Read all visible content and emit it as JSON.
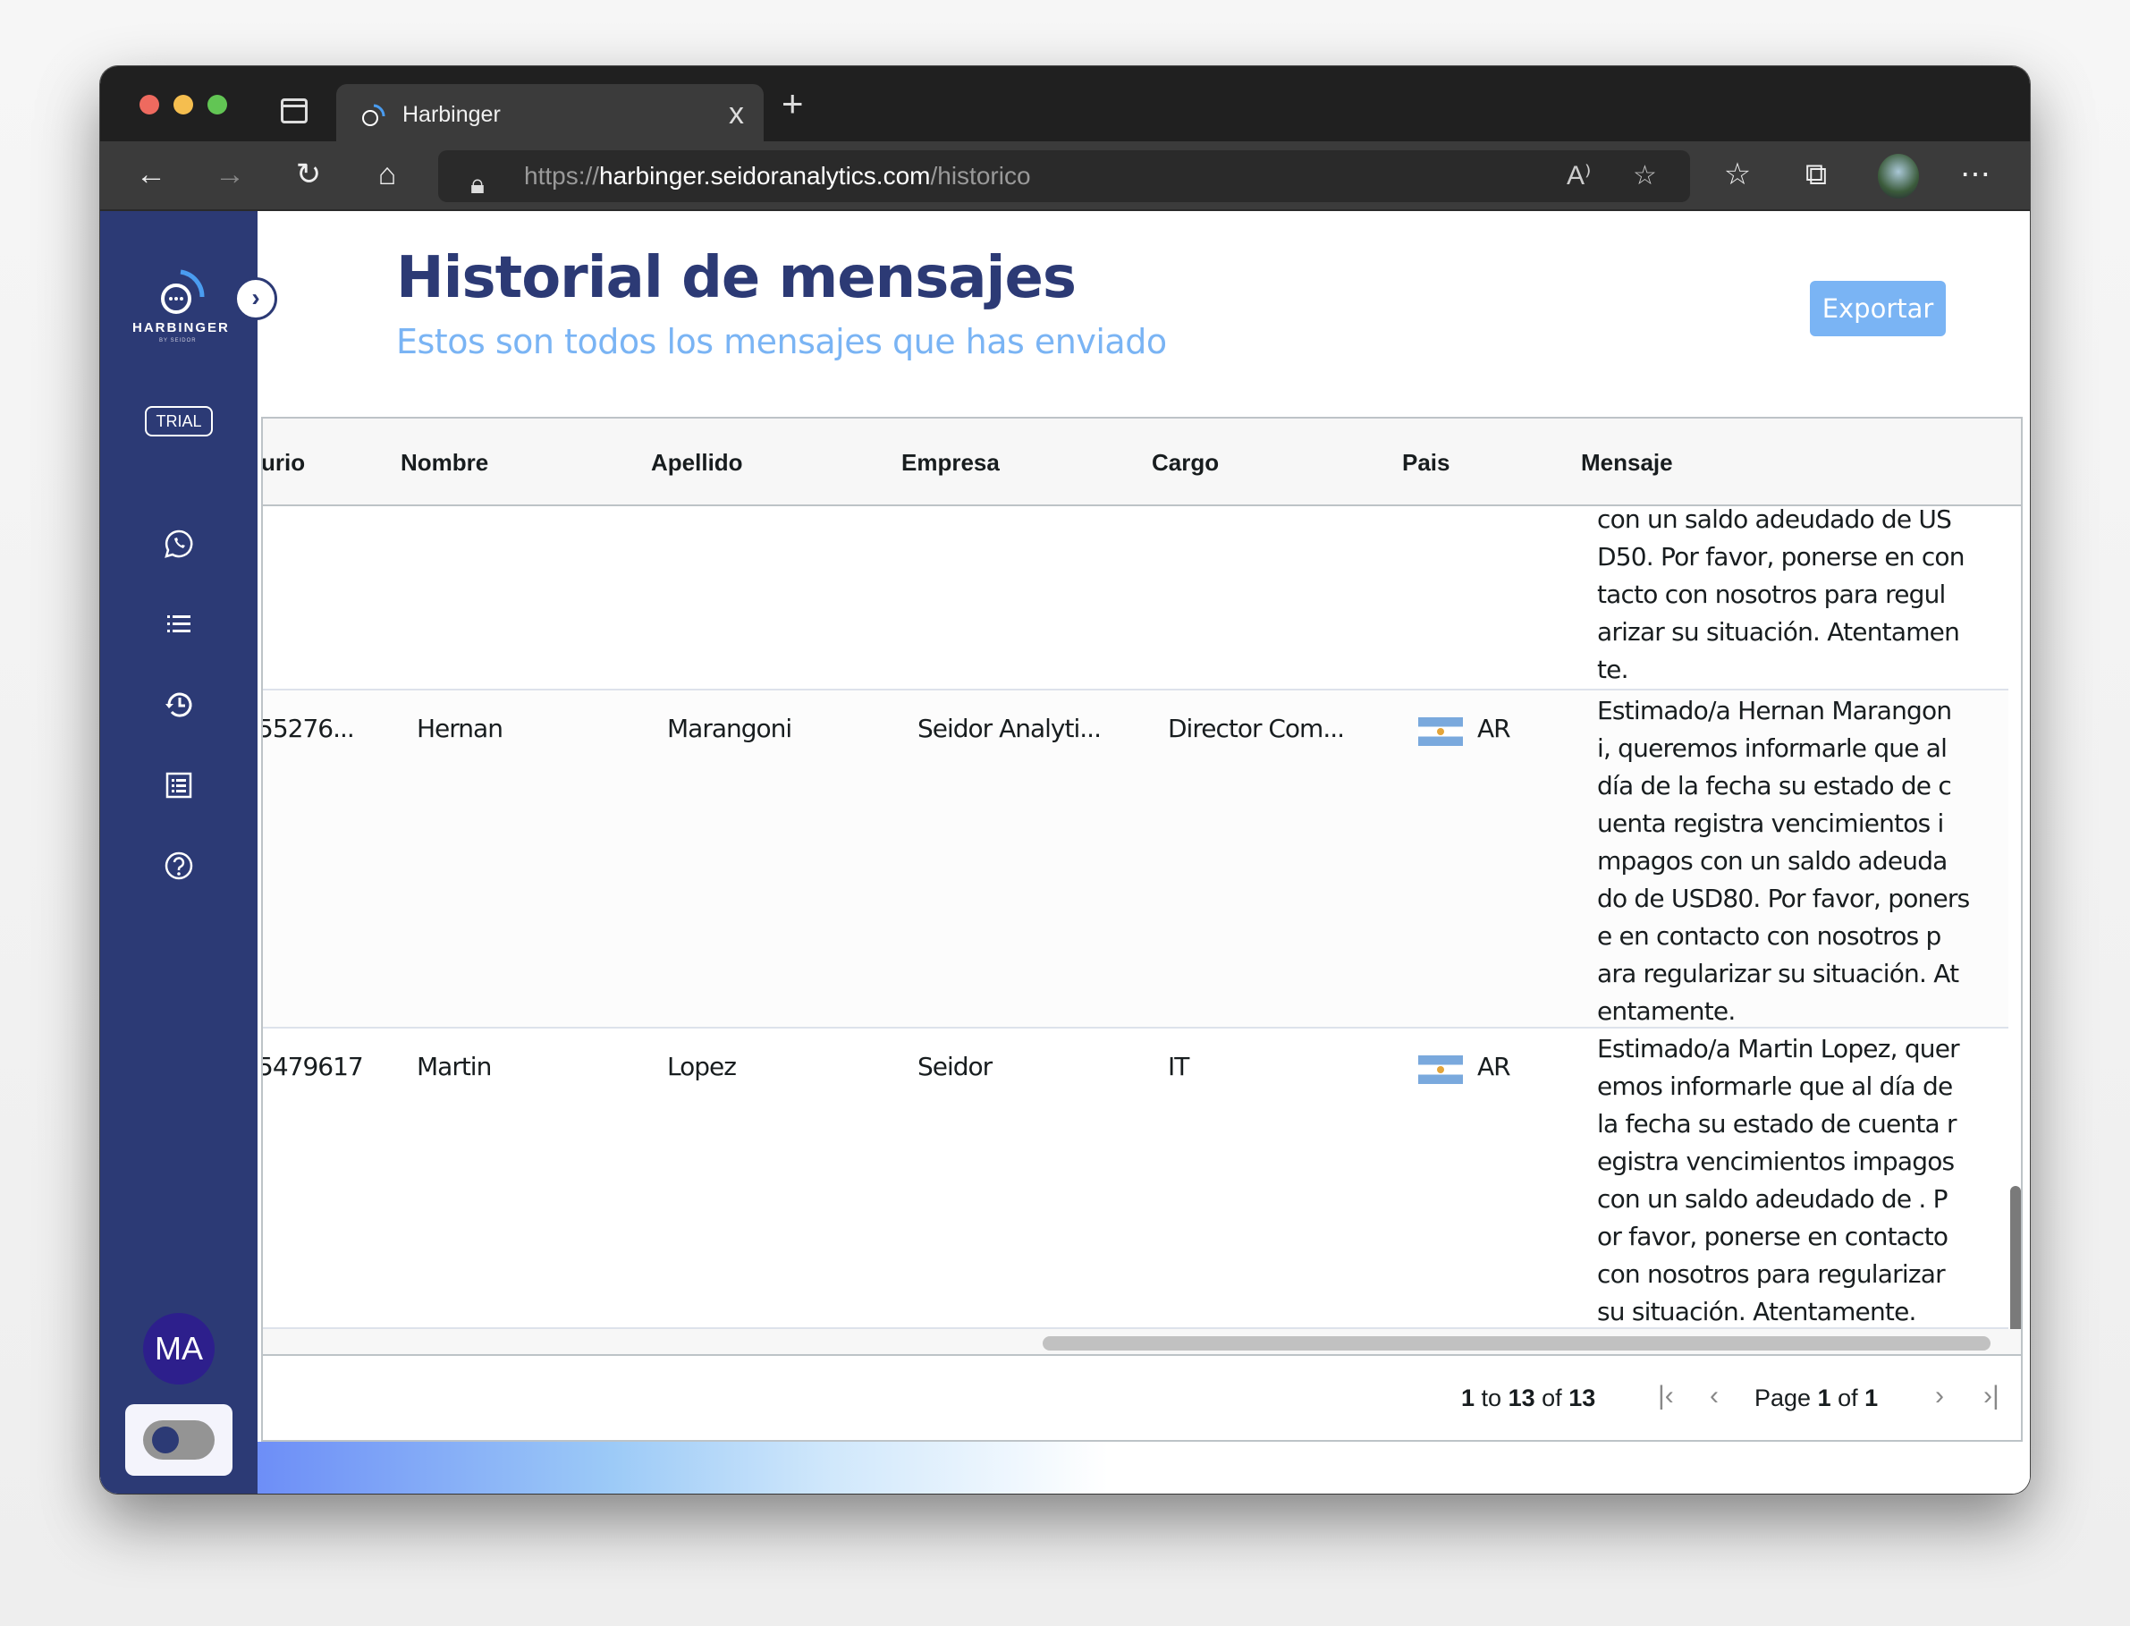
{
  "browser": {
    "tab_title": "Harbinger",
    "tab_close": "x",
    "new_tab": "+",
    "url_prefix": "https://",
    "url_host": "harbinger.seidoranalytics.com",
    "url_path": "/historico",
    "icons": [
      "sidebar-toggle-icon",
      "back-icon",
      "forward-icon",
      "refresh-icon",
      "home-icon",
      "lock-icon",
      "read-aloud-icon",
      "add-favorite-icon",
      "favorites-icon",
      "collections-icon",
      "profile-avatar",
      "more-icon"
    ]
  },
  "sidebar": {
    "logo_name": "HARBINGER",
    "logo_by": "BY SEIDOR",
    "collapse_icon": "›",
    "trial_badge": "TRIAL",
    "items": [
      {
        "name": "whatsapp",
        "icon": "whatsapp-icon"
      },
      {
        "name": "lists",
        "icon": "list-icon"
      },
      {
        "name": "history",
        "icon": "history-icon"
      },
      {
        "name": "templates",
        "icon": "list-box-icon"
      },
      {
        "name": "help",
        "icon": "help-icon"
      }
    ],
    "user_initials": "MA",
    "theme_toggle_on": false
  },
  "header": {
    "title": "Historial de mensajes",
    "subtitle": "Estos son todos los mensajes que has enviado",
    "export_label": "Exportar"
  },
  "table": {
    "columns": [
      "urio",
      "Nombre",
      "Apellido",
      "Empresa",
      "Cargo",
      "Pais",
      "Mensaje"
    ],
    "rows": [
      {
        "usuario": "",
        "nombre": "",
        "apellido": "",
        "empresa": "",
        "cargo": "",
        "pais": "",
        "mensaje": "con un saldo adeudado de USD50. Por favor, ponerse en contacto con nosotros para regularizar su situación. Atentamente."
      },
      {
        "usuario": "55276...",
        "nombre": "Hernan",
        "apellido": "Marangoni",
        "empresa": "Seidor Analyti...",
        "cargo": "Director Com...",
        "pais": "AR",
        "mensaje": "Estimado/a Hernan Marangoni, queremos informarle que al día de la fecha su estado de cuenta registra vencimientos impagos con un saldo adeudado de USD80. Por favor, ponerse en contacto con nosotros para regularizar su situación. Atentamente."
      },
      {
        "usuario": "5479617",
        "nombre": "Martin",
        "apellido": "Lopez",
        "empresa": "Seidor",
        "cargo": "IT",
        "pais": "AR",
        "mensaje": "Estimado/a Martin Lopez, queremos informarle que al día de la fecha su estado de cuenta registra vencimientos impagos con un saldo adeudado de . Por favor, ponerse en contacto con nosotros para regularizar su situación. Atentamente."
      }
    ]
  },
  "pagination": {
    "from": "1",
    "to_word": "to",
    "to": "13",
    "of_word": "of",
    "total": "13",
    "page_word": "Page",
    "page": "1",
    "pages": "1",
    "first_icon": "|‹",
    "prev_icon": "‹",
    "next_icon": "›",
    "last_icon": "›|"
  },
  "colors": {
    "sidebar": "#2c3a75",
    "accent": "#7ab4f4",
    "avatar": "#2d1f8c"
  }
}
